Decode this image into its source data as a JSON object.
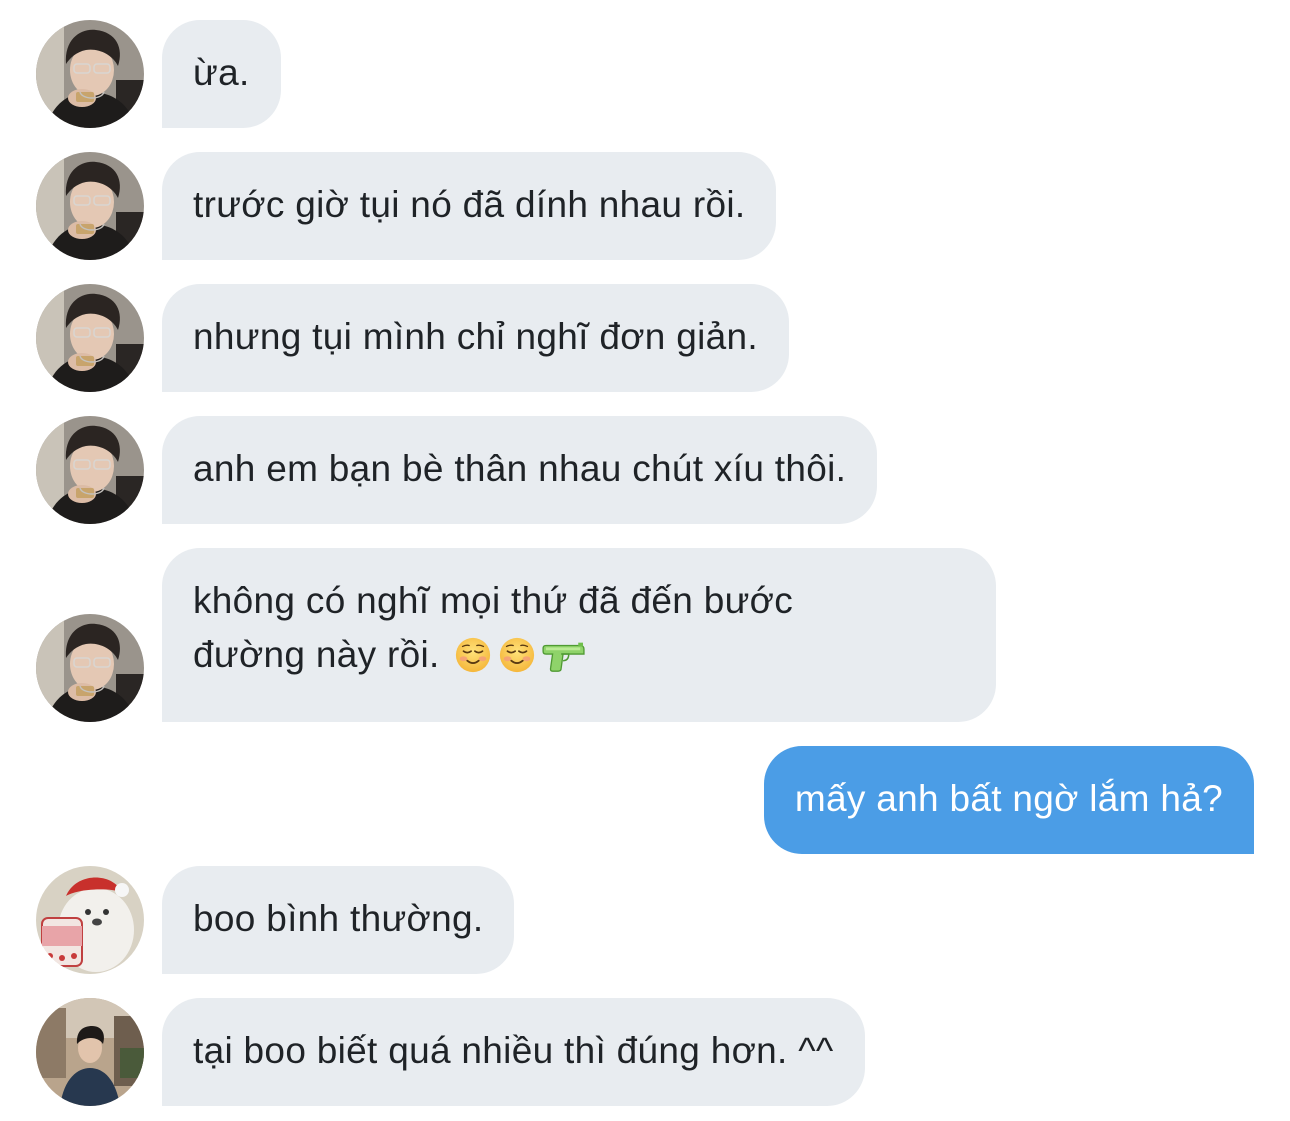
{
  "messages": [
    {
      "sender": "avatar-boy",
      "direction": "in",
      "text": "ừa."
    },
    {
      "sender": "avatar-boy",
      "direction": "in",
      "text": "trước giờ tụi nó đã dính nhau rồi."
    },
    {
      "sender": "avatar-boy",
      "direction": "in",
      "text": "nhưng tụi mình chỉ nghĩ đơn giản."
    },
    {
      "sender": "avatar-boy",
      "direction": "in",
      "text": "anh em bạn bè thân nhau chút xíu thôi."
    },
    {
      "sender": "avatar-boy",
      "direction": "in",
      "line1": "không có nghĩ mọi thứ đã đến bước",
      "line2": "đường này rồi.",
      "emojis": [
        "smiling-face-icon",
        "smiling-face-icon",
        "water-pistol-icon"
      ]
    },
    {
      "sender": "me",
      "direction": "out",
      "text": "mấy anh bất ngờ lắm hả?"
    },
    {
      "sender": "avatar-bear",
      "direction": "in",
      "text": "boo bình thường."
    },
    {
      "sender": "avatar-man",
      "direction": "in",
      "text": "tại boo biết quá nhiều thì đúng hơn. ^^"
    }
  ],
  "colors": {
    "incoming_bubble": "#e8ecf0",
    "outgoing_bubble": "#4b9de6",
    "incoming_text": "#1f2327",
    "outgoing_text": "#ffffff"
  }
}
